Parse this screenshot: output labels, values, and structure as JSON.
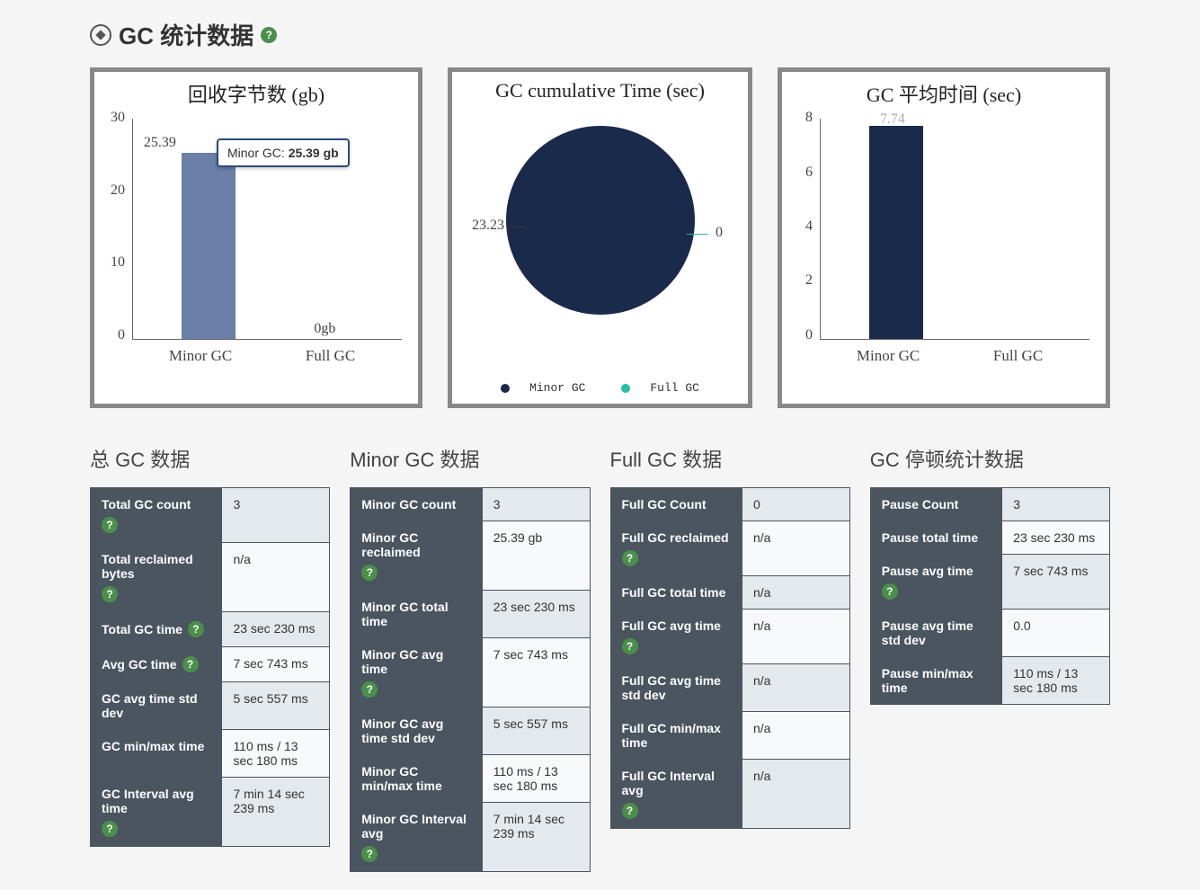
{
  "section_title": "GC 统计数据",
  "chart_data": [
    {
      "type": "bar",
      "title": "回收字节数 (gb)",
      "categories": [
        "Minor GC",
        "Full GC"
      ],
      "values": [
        25.39,
        0
      ],
      "value_labels": [
        "25.39",
        "0gb"
      ],
      "ylim": [
        0,
        30
      ],
      "yticks": [
        0,
        10,
        20,
        30
      ],
      "colors": [
        "#6b7fa8",
        "#1fbfa8"
      ],
      "tooltip": "Minor GC: 25.39 gb"
    },
    {
      "type": "pie",
      "title": "GC cumulative Time (sec)",
      "series": [
        {
          "name": "Minor GC",
          "value": 23.23,
          "label": "23.23",
          "color": "#1a2a4a"
        },
        {
          "name": "Full GC",
          "value": 0,
          "label": "0",
          "color": "#1fbfa8"
        }
      ],
      "legend": [
        "Minor GC",
        "Full GC"
      ]
    },
    {
      "type": "bar",
      "title": "GC 平均时间 (sec)",
      "categories": [
        "Minor GC",
        "Full GC"
      ],
      "values": [
        7.74,
        0
      ],
      "value_labels": [
        "7.74",
        ""
      ],
      "ylim": [
        0,
        8
      ],
      "yticks": [
        0,
        2,
        4,
        6,
        8
      ],
      "colors": [
        "#1a2a4a",
        "#1fbfa8"
      ]
    }
  ],
  "tables": [
    {
      "title": "总 GC 数据",
      "rows": [
        {
          "key": "Total GC count",
          "val": "3",
          "help": true
        },
        {
          "key": "Total reclaimed bytes",
          "val": "n/a",
          "help": true
        },
        {
          "key": "Total GC time",
          "val": "23 sec 230 ms",
          "help": true
        },
        {
          "key": "Avg GC time",
          "val": "7 sec 743 ms",
          "help": true
        },
        {
          "key": "GC avg time std dev",
          "val": "5 sec 557 ms",
          "help": false
        },
        {
          "key": "GC min/max time",
          "val": "110 ms / 13 sec 180 ms",
          "help": false
        },
        {
          "key": "GC Interval avg time",
          "val": "7 min 14 sec 239 ms",
          "help": true
        }
      ]
    },
    {
      "title": "Minor GC 数据",
      "rows": [
        {
          "key": "Minor GC count",
          "val": "3",
          "help": false
        },
        {
          "key": "Minor GC reclaimed",
          "val": "25.39 gb",
          "help": true
        },
        {
          "key": "Minor GC total time",
          "val": "23 sec 230 ms",
          "help": false
        },
        {
          "key": "Minor GC avg time",
          "val": "7 sec 743 ms",
          "help": true
        },
        {
          "key": "Minor GC avg time std dev",
          "val": "5 sec 557 ms",
          "help": false
        },
        {
          "key": "Minor GC min/max time",
          "val": "110 ms / 13 sec 180 ms",
          "help": false
        },
        {
          "key": "Minor GC Interval avg",
          "val": "7 min 14 sec 239 ms",
          "help": true
        }
      ]
    },
    {
      "title": "Full GC 数据",
      "rows": [
        {
          "key": "Full GC Count",
          "val": "0",
          "help": false
        },
        {
          "key": "Full GC reclaimed",
          "val": "n/a",
          "help": true
        },
        {
          "key": "Full GC total time",
          "val": "n/a",
          "help": false
        },
        {
          "key": "Full GC avg time",
          "val": "n/a",
          "help": true
        },
        {
          "key": "Full GC avg time std dev",
          "val": "n/a",
          "help": false
        },
        {
          "key": "Full GC min/max time",
          "val": "n/a",
          "help": false
        },
        {
          "key": "Full GC Interval avg",
          "val": "n/a",
          "help": true
        }
      ]
    },
    {
      "title": "GC 停顿统计数据",
      "rows": [
        {
          "key": "Pause Count",
          "val": "3",
          "help": false
        },
        {
          "key": "Pause total time",
          "val": "23 sec 230 ms",
          "help": false
        },
        {
          "key": "Pause avg time",
          "val": "7 sec 743 ms",
          "help": true
        },
        {
          "key": "Pause avg time std dev",
          "val": "0.0",
          "help": false
        },
        {
          "key": "Pause min/max time",
          "val": "110 ms / 13 sec 180 ms",
          "help": false
        }
      ]
    }
  ]
}
